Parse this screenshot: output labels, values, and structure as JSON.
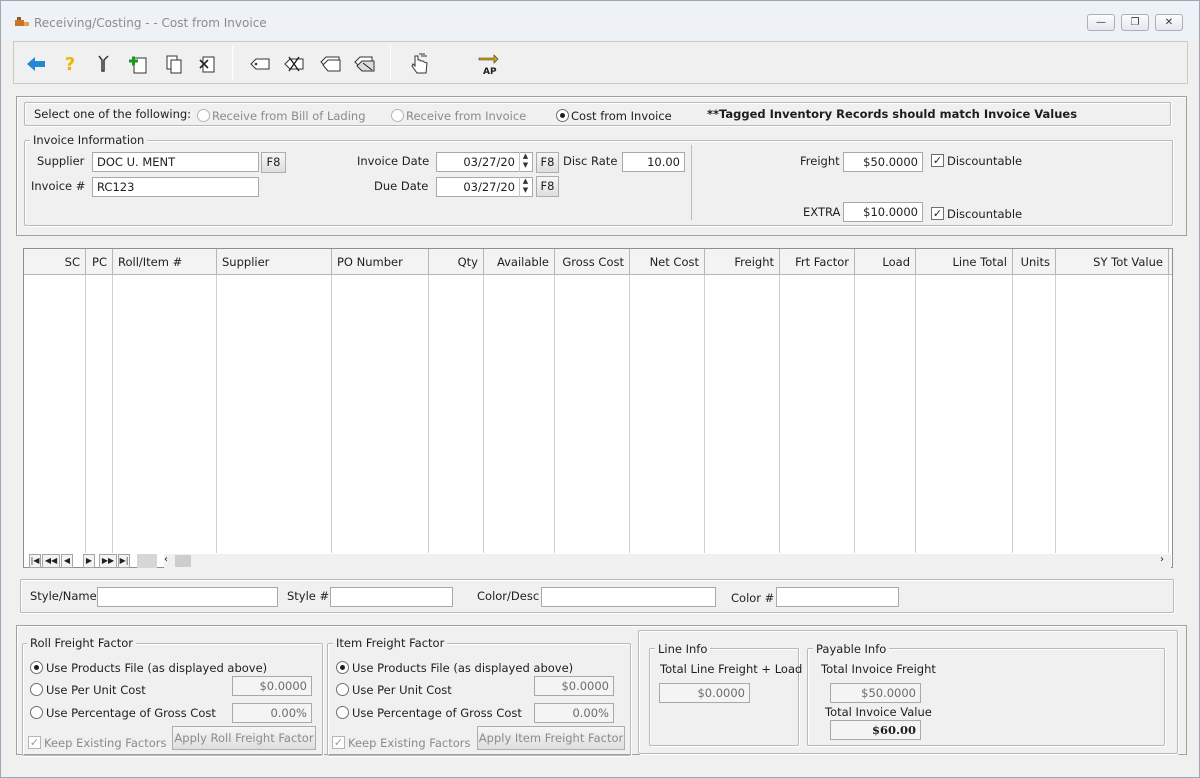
{
  "window": {
    "title": "Receiving/Costing - - Cost from Invoice",
    "controls": [
      "minimize",
      "restore",
      "close"
    ]
  },
  "toolbar": {
    "icons": [
      "back-arrow-icon",
      "help-icon",
      "tools-icon",
      "add-document-icon",
      "copy-document-icon",
      "delete-document-icon",
      "tag-icon",
      "delete-tag-icon",
      "tag-list-icon",
      "print-tags-icon",
      "hand-pointer-icon",
      "ap-transfer-icon"
    ],
    "ap_label": "AP"
  },
  "mode": {
    "prompt": "Select one of the following:",
    "options": [
      {
        "label": "Receive from Bill of Lading",
        "selected": false,
        "enabled": false
      },
      {
        "label": "Receive from Invoice",
        "selected": false,
        "enabled": false
      },
      {
        "label": "Cost from Invoice",
        "selected": true,
        "enabled": true
      }
    ],
    "note": "**Tagged Inventory Records should match Invoice Values"
  },
  "invoice": {
    "group_label": "Invoice Information",
    "supplier_label": "Supplier",
    "supplier_value": "DOC U. MENT",
    "invoice_no_label": "Invoice #",
    "invoice_no_value": "RC123",
    "lookup_label": "F8",
    "invoice_date_label": "Invoice Date",
    "invoice_date_value": "03/27/20",
    "due_date_label": "Due Date",
    "due_date_value": "03/27/20",
    "disc_rate_label": "Disc Rate",
    "disc_rate_value": "10.00",
    "freight_label": "Freight",
    "freight_value": "$50.0000",
    "extra_label": "EXTRA",
    "extra_value": "$10.0000",
    "discountable_label": "Discountable",
    "freight_discountable": true,
    "extra_discountable": true
  },
  "grid": {
    "columns": [
      "SC",
      "PC",
      "Roll/Item #",
      "Supplier",
      "PO Number",
      "Qty",
      "Available",
      "Gross Cost",
      "Net Cost",
      "Freight",
      "Frt Factor",
      "Load",
      "Line Total",
      "Units",
      "SY Tot Value"
    ],
    "rows": [],
    "nav": [
      "|◀",
      "◀◀",
      "◀",
      "▶",
      "▶▶",
      "▶|"
    ]
  },
  "detail": {
    "style_name_label": "Style/Name",
    "style_name_value": "",
    "style_no_label": "Style #",
    "style_no_value": "",
    "color_desc_label": "Color/Desc",
    "color_desc_value": "",
    "color_no_label": "Color #",
    "color_no_value": ""
  },
  "roll_freight": {
    "group_label": "Roll Freight Factor",
    "options": [
      {
        "label": "Use Products File (as displayed above)",
        "selected": true
      },
      {
        "label": "Use Per Unit Cost",
        "selected": false
      },
      {
        "label": "Use Percentage of Gross Cost",
        "selected": false
      }
    ],
    "per_unit_value": "$0.0000",
    "percentage_value": "0.00%",
    "keep_label": "Keep Existing Factors",
    "keep_checked": true,
    "apply_label": "Apply Roll Freight Factor"
  },
  "item_freight": {
    "group_label": "Item Freight Factor",
    "options": [
      {
        "label": "Use Products File (as displayed above)",
        "selected": true
      },
      {
        "label": "Use Per Unit Cost",
        "selected": false
      },
      {
        "label": "Use Percentage of Gross Cost",
        "selected": false
      }
    ],
    "per_unit_value": "$0.0000",
    "percentage_value": "0.00%",
    "keep_label": "Keep Existing Factors",
    "keep_checked": true,
    "apply_label": "Apply Item Freight Factor"
  },
  "line_info": {
    "group_label": "Line Info",
    "total_label": "Total Line Freight + Load",
    "total_value": "$0.0000"
  },
  "payable_info": {
    "group_label": "Payable Info",
    "freight_label": "Total Invoice Freight",
    "freight_value": "$50.0000",
    "value_label": "Total Invoice Value",
    "value_value": "$60.00"
  }
}
